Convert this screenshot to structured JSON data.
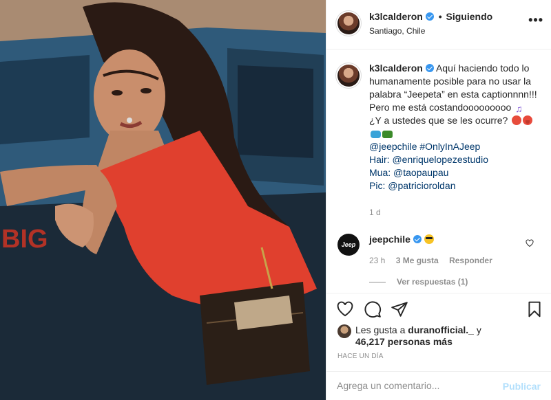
{
  "header": {
    "username": "k3lcalderon",
    "separator": "•",
    "follow_state": "Siguiendo",
    "location": "Santiago, Chile",
    "more_label": "•••"
  },
  "caption": {
    "username": "k3lcalderon",
    "line1": "Aquí haciendo todo lo humanamente posible para no usar la palabra “Jeepeta” en esta captionnnn!!! Pero me está costandooooooooo",
    "line2": "¿Y a ustedes que se les ocurre?",
    "hashtags": "@jeepchile #OnlyInAJeep",
    "hair_label": "Hair:",
    "hair_handle": "@enriquelopezestudio",
    "mua_label": "Mua:",
    "mua_handle": "@taopaupau",
    "pic_label": "Pic:",
    "pic_handle": "@patricioroldan",
    "time": "1 d"
  },
  "comment": {
    "avatar_text": "Jeep",
    "username": "jeepchile",
    "time": "23 h",
    "likes": "3 Me gusta",
    "reply": "Responder",
    "view_replies": "Ver respuestas (1)"
  },
  "likes": {
    "prefix": "Les gusta a",
    "user": "duranofficial._",
    "conj": "y",
    "count": "46,217 personas más"
  },
  "posted": "Hace un día",
  "compose": {
    "placeholder": "Agrega un comentario...",
    "publish": "Publicar"
  },
  "colors": {
    "link": "#00376b",
    "verified": "#3897f0",
    "publish_disabled": "#b2dffc",
    "swimsuit": "#e0402e"
  }
}
